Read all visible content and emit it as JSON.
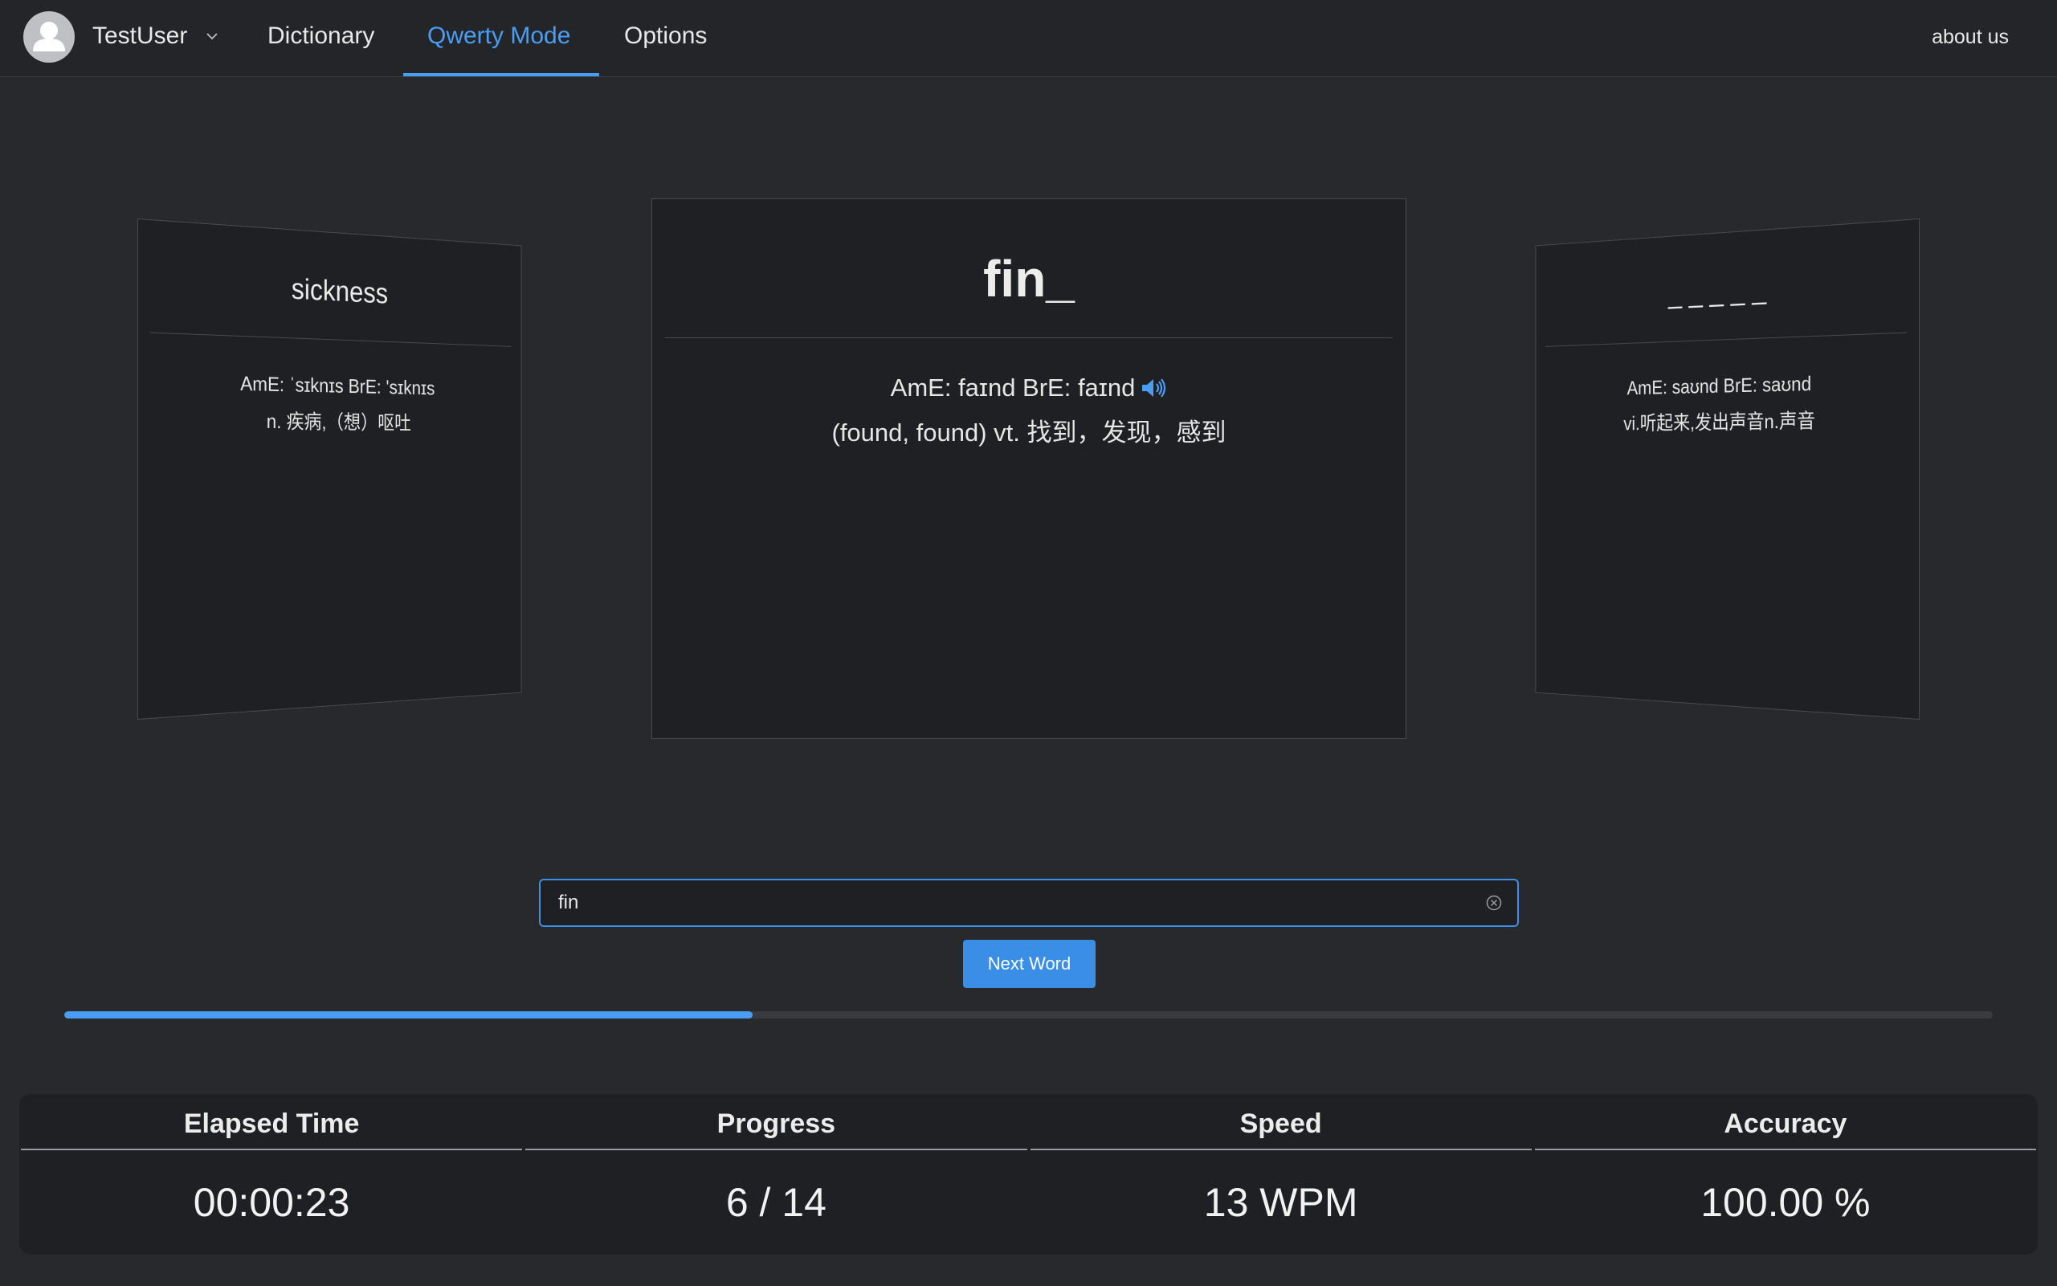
{
  "header": {
    "user_name": "TestUser",
    "nav": [
      {
        "label": "Dictionary",
        "active": false
      },
      {
        "label": "Qwerty Mode",
        "active": true
      },
      {
        "label": "Options",
        "active": false
      }
    ],
    "about": "about us",
    "accent_color": "#4a9df5"
  },
  "cards": {
    "previous": {
      "word": "sickness",
      "phonetic": "AmE: ˈsɪknɪs BrE: 'sɪknɪs",
      "definition": "n. 疾病,（想）呕吐"
    },
    "current": {
      "word": "fin_",
      "phonetic": "AmE: faɪnd BrE: faɪnd",
      "definition": "(found, found) vt. 找到，发现，感到",
      "sound_icon": "speaker-icon"
    },
    "next": {
      "word": "_ _ _ _ _",
      "phonetic": "AmE: saʊnd BrE: saʊnd",
      "definition": "vi.听起来,发出声音n.声音"
    }
  },
  "input": {
    "value": "fin",
    "clear_icon": "clear-circle-icon"
  },
  "next_button": "Next Word",
  "progress_fraction": 0.357,
  "stats": [
    {
      "label": "Elapsed Time",
      "value": "00:00:23"
    },
    {
      "label": "Progress",
      "value": "6 / 14"
    },
    {
      "label": "Speed",
      "value": "13 WPM"
    },
    {
      "label": "Accuracy",
      "value": "100.00 %"
    }
  ]
}
